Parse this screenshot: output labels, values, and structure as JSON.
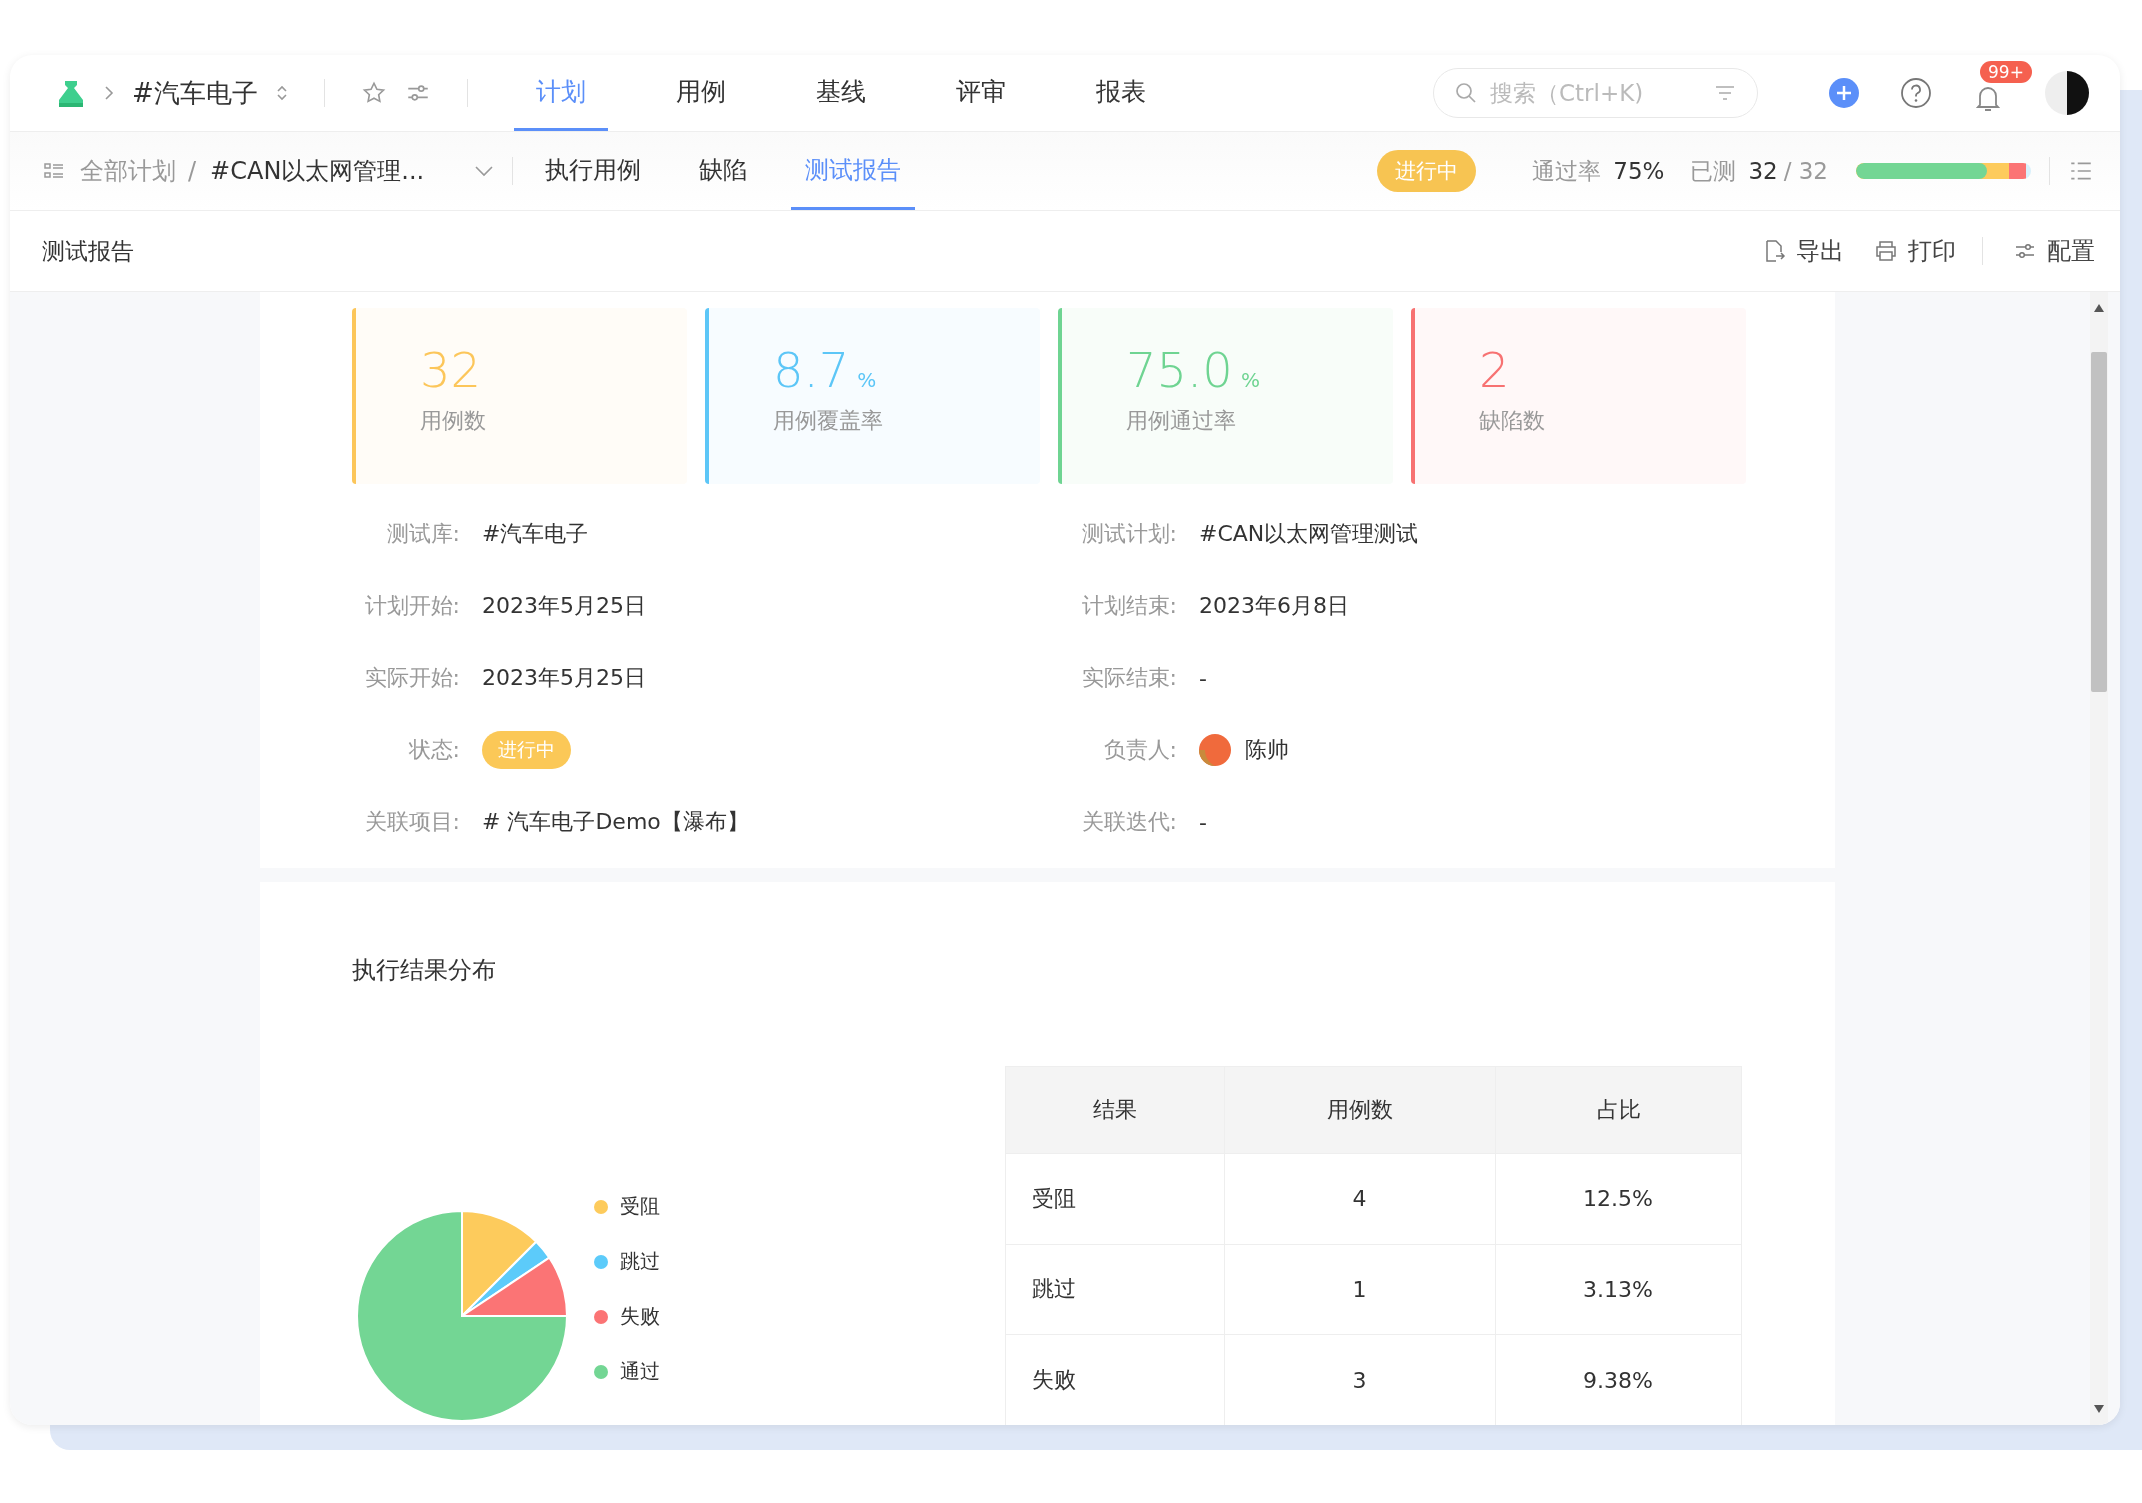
{
  "top_bar": {
    "project": "#汽车电子",
    "tabs": [
      {
        "label": "计划",
        "selected": true
      },
      {
        "label": "用例",
        "selected": false
      },
      {
        "label": "基线",
        "selected": false
      },
      {
        "label": "评审",
        "selected": false
      },
      {
        "label": "报表",
        "selected": false
      }
    ],
    "search": {
      "placeholder": "搜索（Ctrl+K)"
    },
    "notification_badge": "99+"
  },
  "sub_bar": {
    "breadcrumb": [
      "全部计划",
      "/",
      "#CAN以太网管理..."
    ],
    "tabs": [
      {
        "label": "执行用例",
        "selected": false
      },
      {
        "label": "缺陷",
        "selected": false
      },
      {
        "label": "测试报告",
        "selected": true
      }
    ],
    "status": "进行中",
    "pass_rate_label": "通过率",
    "pass_rate": "75%",
    "tested_label": "已测",
    "tested": "32",
    "total": "/ 32",
    "progress": {
      "level": 0.75
    }
  },
  "toolbar": {
    "title": "测试报告",
    "actions": [
      {
        "kind": "export",
        "label": "导出"
      },
      {
        "kind": "print",
        "label": "打印"
      },
      {
        "kind": "config",
        "label": "配置"
      }
    ]
  },
  "stats": [
    {
      "value": "32",
      "label": "用例数",
      "color": "#fcc65a"
    },
    {
      "value": "8.7",
      "unit": "%",
      "label": "用例覆盖率",
      "color": "#5cc6f7"
    },
    {
      "value": "75.0",
      "unit": "%",
      "label": "用例通过率",
      "color": "#6fd492"
    },
    {
      "value": "2",
      "label": "缺陷数",
      "color": "#f77272"
    }
  ],
  "info": [
    {
      "label": "测试库:",
      "value": "#汽车电子",
      "kind": "text"
    },
    {
      "label": "测试计划:",
      "value": "#CAN以太网管理测试",
      "kind": "text"
    },
    {
      "label": "计划开始:",
      "value": "2023年5月25日",
      "kind": "text"
    },
    {
      "label": "计划结束:",
      "value": "2023年6月8日",
      "kind": "text"
    },
    {
      "label": "实际开始:",
      "value": "2023年5月25日",
      "kind": "text"
    },
    {
      "label": "实际结束:",
      "value": "-",
      "kind": "text"
    },
    {
      "label": "状态:",
      "value": "进行中",
      "kind": "status"
    },
    {
      "label": "负责人:",
      "value": "陈帅",
      "kind": "person"
    },
    {
      "label": "关联项目:",
      "value": "# 汽车电子Demo【瀑布】",
      "kind": "text"
    },
    {
      "label": "关联迭代:",
      "value": "-",
      "kind": "text"
    }
  ],
  "distribution": {
    "title": "执行结果分布",
    "chart_data": {
      "type": "pie",
      "categories": [
        "受阻",
        "跳过",
        "失败",
        "通过"
      ],
      "values": [
        12.5,
        3.13,
        9.38,
        75
      ],
      "legend": "right",
      "colors": [
        "#fdcb5c",
        "#5ccbfa",
        "#fb7475",
        "#73d694"
      ]
    },
    "table": {
      "columns": [
        "结果",
        "用例数",
        "占比"
      ],
      "rows": [
        [
          "受阻",
          "4",
          "12.5%"
        ],
        [
          "跳过",
          "1",
          "3.13%"
        ],
        [
          "失败",
          "3",
          "9.38%"
        ]
      ]
    }
  }
}
